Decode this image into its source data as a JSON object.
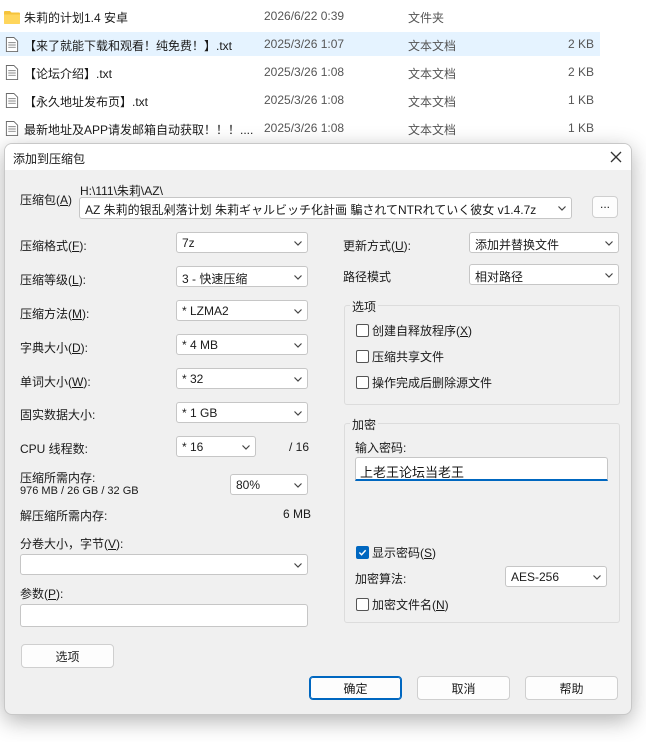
{
  "file_list": {
    "rows": [
      {
        "name": "朱莉的计划1.4 安卓",
        "date": "2026/6/22 0:39",
        "type": "文件夹",
        "size": "",
        "icon": "folder-icon"
      },
      {
        "name": "【来了就能下载和观看！纯免费！】.txt",
        "date": "2025/3/26 1:07",
        "type": "文本文档",
        "size": "2 KB",
        "icon": "text-file-icon"
      },
      {
        "name": "【论坛介绍】.txt",
        "date": "2025/3/26 1:08",
        "type": "文本文档",
        "size": "2 KB",
        "icon": "text-file-icon"
      },
      {
        "name": "【永久地址发布页】.txt",
        "date": "2025/3/26 1:08",
        "type": "文本文档",
        "size": "1 KB",
        "icon": "text-file-icon"
      },
      {
        "name": "最新地址及APP请发邮箱自动获取！！！....",
        "date": "2025/3/26 1:08",
        "type": "文本文档",
        "size": "1 KB",
        "icon": "text-file-icon"
      }
    ]
  },
  "dialog": {
    "title": "添加到压缩包",
    "archive": {
      "label": "压缩包(",
      "label_key": "A",
      "label_end": ")",
      "path": "H:\\111\\朱莉\\AZ\\",
      "filename": "AZ 朱莉的银乱剁落计划 朱莉ギャルビッチ化計画 騙されてNTRれていく彼女 v1.4.7z",
      "browse_label": "..."
    },
    "format": {
      "label": "压缩格式(",
      "key": "F",
      "end": "):",
      "value": "7z"
    },
    "level": {
      "label": "压缩等级(",
      "key": "L",
      "end": "):",
      "value": "3 - 快速压缩"
    },
    "method": {
      "label": "压缩方法(",
      "key": "M",
      "end": "):",
      "value": "*  LZMA2"
    },
    "dict": {
      "label": "字典大小(",
      "key": "D",
      "end": "):",
      "value": "*  4 MB"
    },
    "word": {
      "label": "单词大小(",
      "key": "W",
      "end": "):",
      "value": "*  32"
    },
    "solid": {
      "label": "固实数据大小:",
      "value": "*  1 GB"
    },
    "threads": {
      "label": "CPU 线程数:",
      "value": "*  16",
      "max": "/ 16"
    },
    "memory": {
      "label": "压缩所需内存:",
      "detail": "976 MB / 26 GB / 32 GB",
      "percent": "80%"
    },
    "decomp_memory": {
      "label": "解压缩所需内存:",
      "value": "6 MB"
    },
    "volume": {
      "label": "分卷大小，字节(",
      "key": "V",
      "end": "):",
      "value": ""
    },
    "params": {
      "label": "参数(",
      "key": "P",
      "end": "):",
      "value": ""
    },
    "options_button": "选项",
    "update_mode": {
      "label": "更新方式(",
      "key": "U",
      "end": "):",
      "value": "添加并替换文件"
    },
    "path_mode": {
      "label": "路径模式",
      "value": "相对路径"
    },
    "options_group": {
      "title": "选项",
      "sfx": {
        "label": "创建自释放程序(",
        "key": "X",
        "end": ")",
        "checked": false
      },
      "shared": {
        "label": "压缩共享文件",
        "checked": false
      },
      "delete": {
        "label": "操作完成后删除源文件",
        "checked": false
      }
    },
    "encryption": {
      "title": "加密",
      "password_label": "输入密码:",
      "password_value": "上老王论坛当老王",
      "show_password": {
        "label": "显示密码(",
        "key": "S",
        "end": ")",
        "checked": true
      },
      "method_label": "加密算法:",
      "method_value": "AES-256",
      "encrypt_names": {
        "label": "加密文件名(",
        "key": "N",
        "end": ")",
        "checked": false
      }
    },
    "buttons": {
      "ok": "确定",
      "cancel": "取消",
      "help": "帮助"
    }
  },
  "colors": {
    "accent": "#0067c0",
    "selected_row": "#e5f3ff",
    "folder": "#f5c33b"
  }
}
